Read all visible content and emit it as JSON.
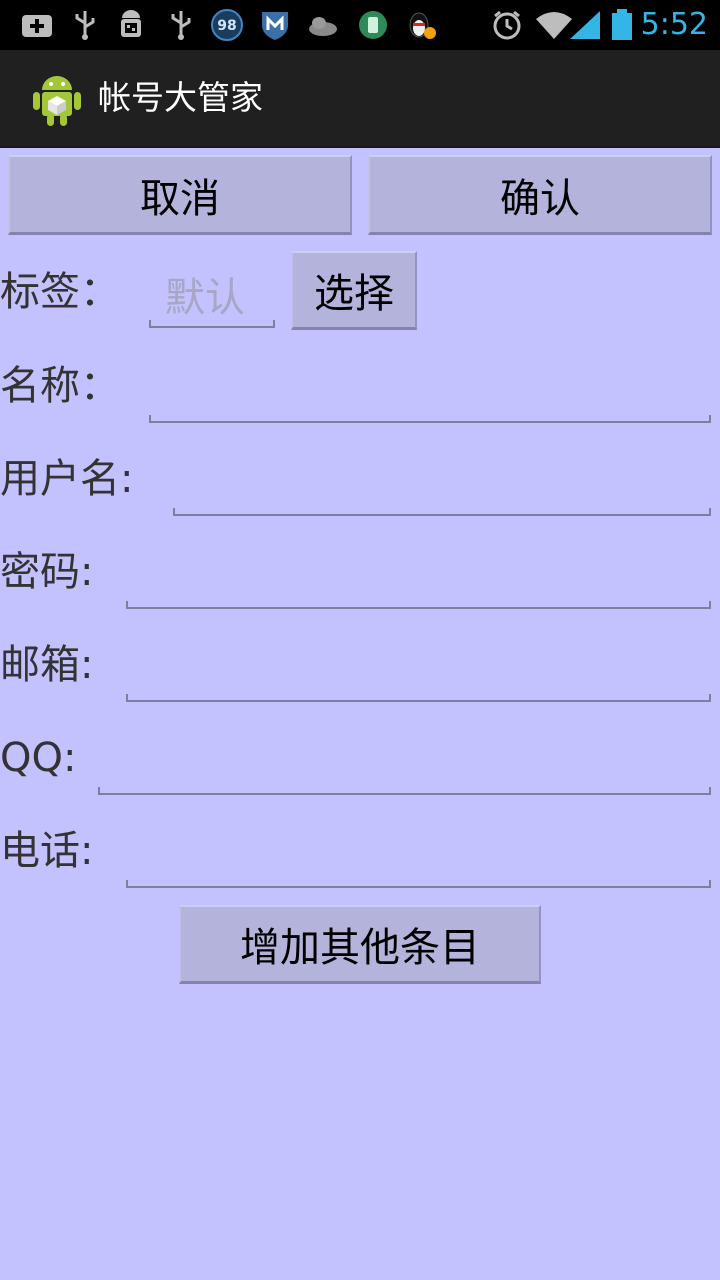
{
  "status_bar": {
    "time": "5:52",
    "badge_number": "98",
    "icons": [
      "add-icon",
      "usb-icon",
      "android-debug-icon",
      "usb-icon",
      "badge-98-icon",
      "shield-m-icon",
      "cloud-icon",
      "app-icon",
      "qq-penguin-icon",
      "alarm-icon",
      "wifi-icon",
      "signal-icon",
      "battery-icon"
    ]
  },
  "app_bar": {
    "title": "帐号大管家"
  },
  "actions": {
    "cancel": "取消",
    "confirm": "确认"
  },
  "form": {
    "tag": {
      "label": "标签：",
      "placeholder": "默认",
      "select_button": "选择"
    },
    "fields": [
      {
        "label": "名称：",
        "value": ""
      },
      {
        "label": "用户名:",
        "value": ""
      },
      {
        "label": "密码:",
        "value": ""
      },
      {
        "label": "邮箱:",
        "value": ""
      },
      {
        "label": "QQ:",
        "value": ""
      },
      {
        "label": "电话:",
        "value": ""
      }
    ],
    "add_button": "增加其他条目"
  },
  "colors": {
    "background": "#c3c1fe",
    "button": "#b4b3dc",
    "status_time": "#33b5e5",
    "action_bar": "#202020"
  }
}
